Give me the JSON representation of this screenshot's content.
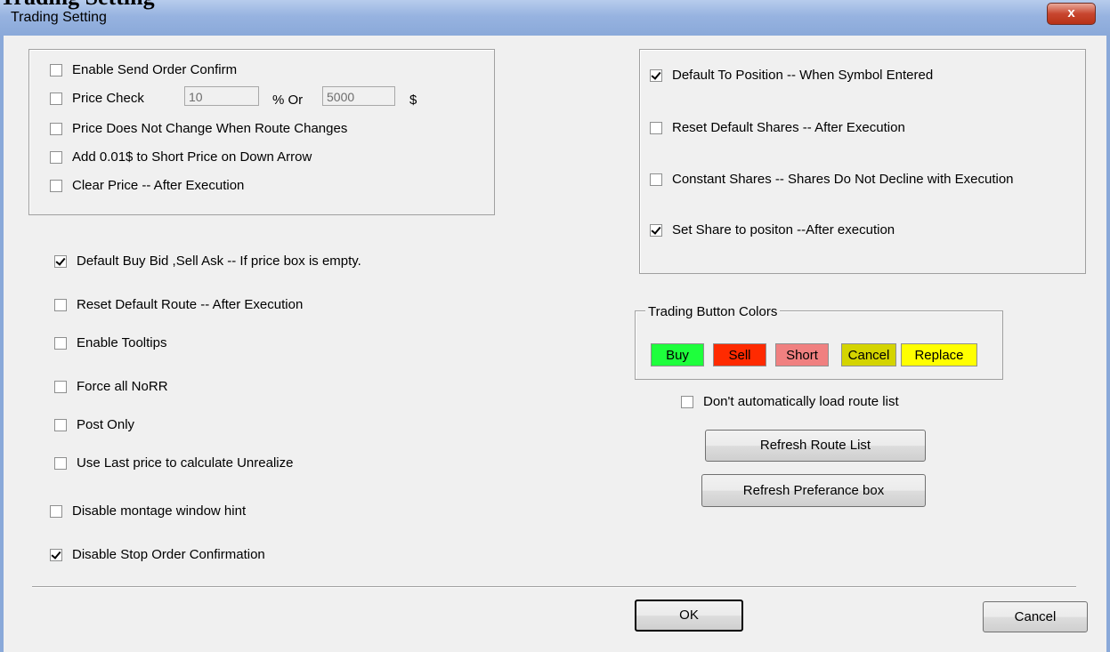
{
  "window": {
    "title": "Trading Setting",
    "faux_title": "Trading Setting",
    "close_label": "x"
  },
  "price_group": {
    "enable_send_order_confirm": {
      "label": "Enable Send Order Confirm",
      "checked": false
    },
    "price_check": {
      "label": "Price Check",
      "checked": false,
      "percent_value": "10",
      "percent_label": "% Or",
      "dollar_value": "5000",
      "dollar_label": "$"
    },
    "price_no_change_route": {
      "label": "Price Does Not Change When Route Changes",
      "checked": false
    },
    "add_short_price": {
      "label": "Add 0.01$ to Short Price on Down Arrow",
      "checked": false
    },
    "clear_price": {
      "label": "Clear Price -- After Execution",
      "checked": false
    }
  },
  "left_options": [
    {
      "label": "Default Buy Bid ,Sell Ask -- If price box is empty.",
      "checked": true
    },
    {
      "label": "Reset Default Route -- After Execution",
      "checked": false
    },
    {
      "label": "Enable Tooltips",
      "checked": false
    },
    {
      "label": "Force all NoRR",
      "checked": false
    },
    {
      "label": "Post Only",
      "checked": false
    },
    {
      "label": "Use Last price to calculate Unrealize",
      "checked": false
    },
    {
      "label": "Disable montage window hint",
      "checked": false
    },
    {
      "label": "Disable Stop Order Confirmation",
      "checked": true
    }
  ],
  "shares_group": [
    {
      "label": "Default To Position -- When Symbol Entered",
      "checked": true
    },
    {
      "label": "Reset Default Shares -- After Execution",
      "checked": false
    },
    {
      "label": "Constant Shares -- Shares Do Not Decline with Execution",
      "checked": false
    },
    {
      "label": "Set Share to positon --After execution",
      "checked": true
    }
  ],
  "button_colors": {
    "title": "Trading Button Colors",
    "items": [
      {
        "label": "Buy",
        "color": "#1eff3c"
      },
      {
        "label": "Sell",
        "color": "#ff2a00"
      },
      {
        "label": "Short",
        "color": "#f08080"
      },
      {
        "label": "Cancel",
        "color": "#d4d400"
      },
      {
        "label": "Replace",
        "color": "#ffff00"
      }
    ]
  },
  "route": {
    "dont_auto_load": {
      "label": "Don't automatically load route list",
      "checked": false
    },
    "refresh_route_list": "Refresh Route List",
    "refresh_preference_box": "Refresh Preferance box"
  },
  "footer": {
    "ok": "OK",
    "cancel": "Cancel"
  }
}
